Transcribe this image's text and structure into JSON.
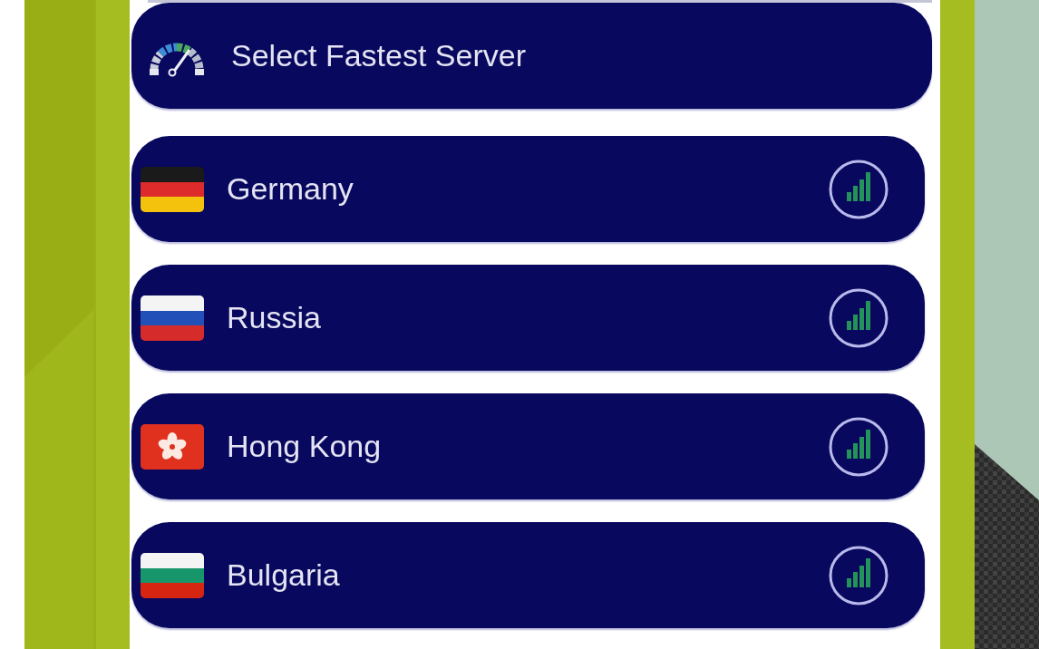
{
  "fastest_server": {
    "label": "Select Fastest Server"
  },
  "servers": [
    {
      "name": "Germany",
      "kind": "de"
    },
    {
      "name": "Russia",
      "kind": "ru"
    },
    {
      "name": "Hong Kong",
      "kind": "hk"
    },
    {
      "name": "Bulgaria",
      "kind": "bg"
    }
  ]
}
